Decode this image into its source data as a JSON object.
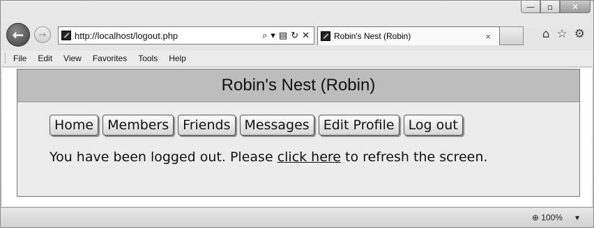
{
  "browser": {
    "address_url": "http://localhost/logout.php",
    "tab_title": "Robin's Nest (Robin)",
    "tab_close_glyph": "×",
    "minimize_glyph": "—",
    "maximize_glyph": "▫",
    "close_glyph": "✕",
    "back_glyph": "←",
    "forward_glyph": "→",
    "search_glyph": "⌕",
    "dropdown_glyph": "▾",
    "compat_glyph": "▤",
    "refresh_glyph": "↻",
    "stop_glyph": "✕",
    "home_glyph": "⌂",
    "favorites_glyph": "☆",
    "settings_glyph": "⚙"
  },
  "menu": [
    "File",
    "Edit",
    "View",
    "Favorites",
    "Tools",
    "Help"
  ],
  "page": {
    "header": "Robin's Nest (Robin)",
    "nav": [
      "Home",
      "Members",
      "Friends",
      "Messages",
      "Edit Profile",
      "Log out"
    ],
    "message_before": "You have been logged out. Please ",
    "message_link": "click here",
    "message_after": " to refresh the screen."
  },
  "status": {
    "zoom": "100%",
    "zoom_glyph": "⊕",
    "zoom_dropdown": "▾"
  }
}
